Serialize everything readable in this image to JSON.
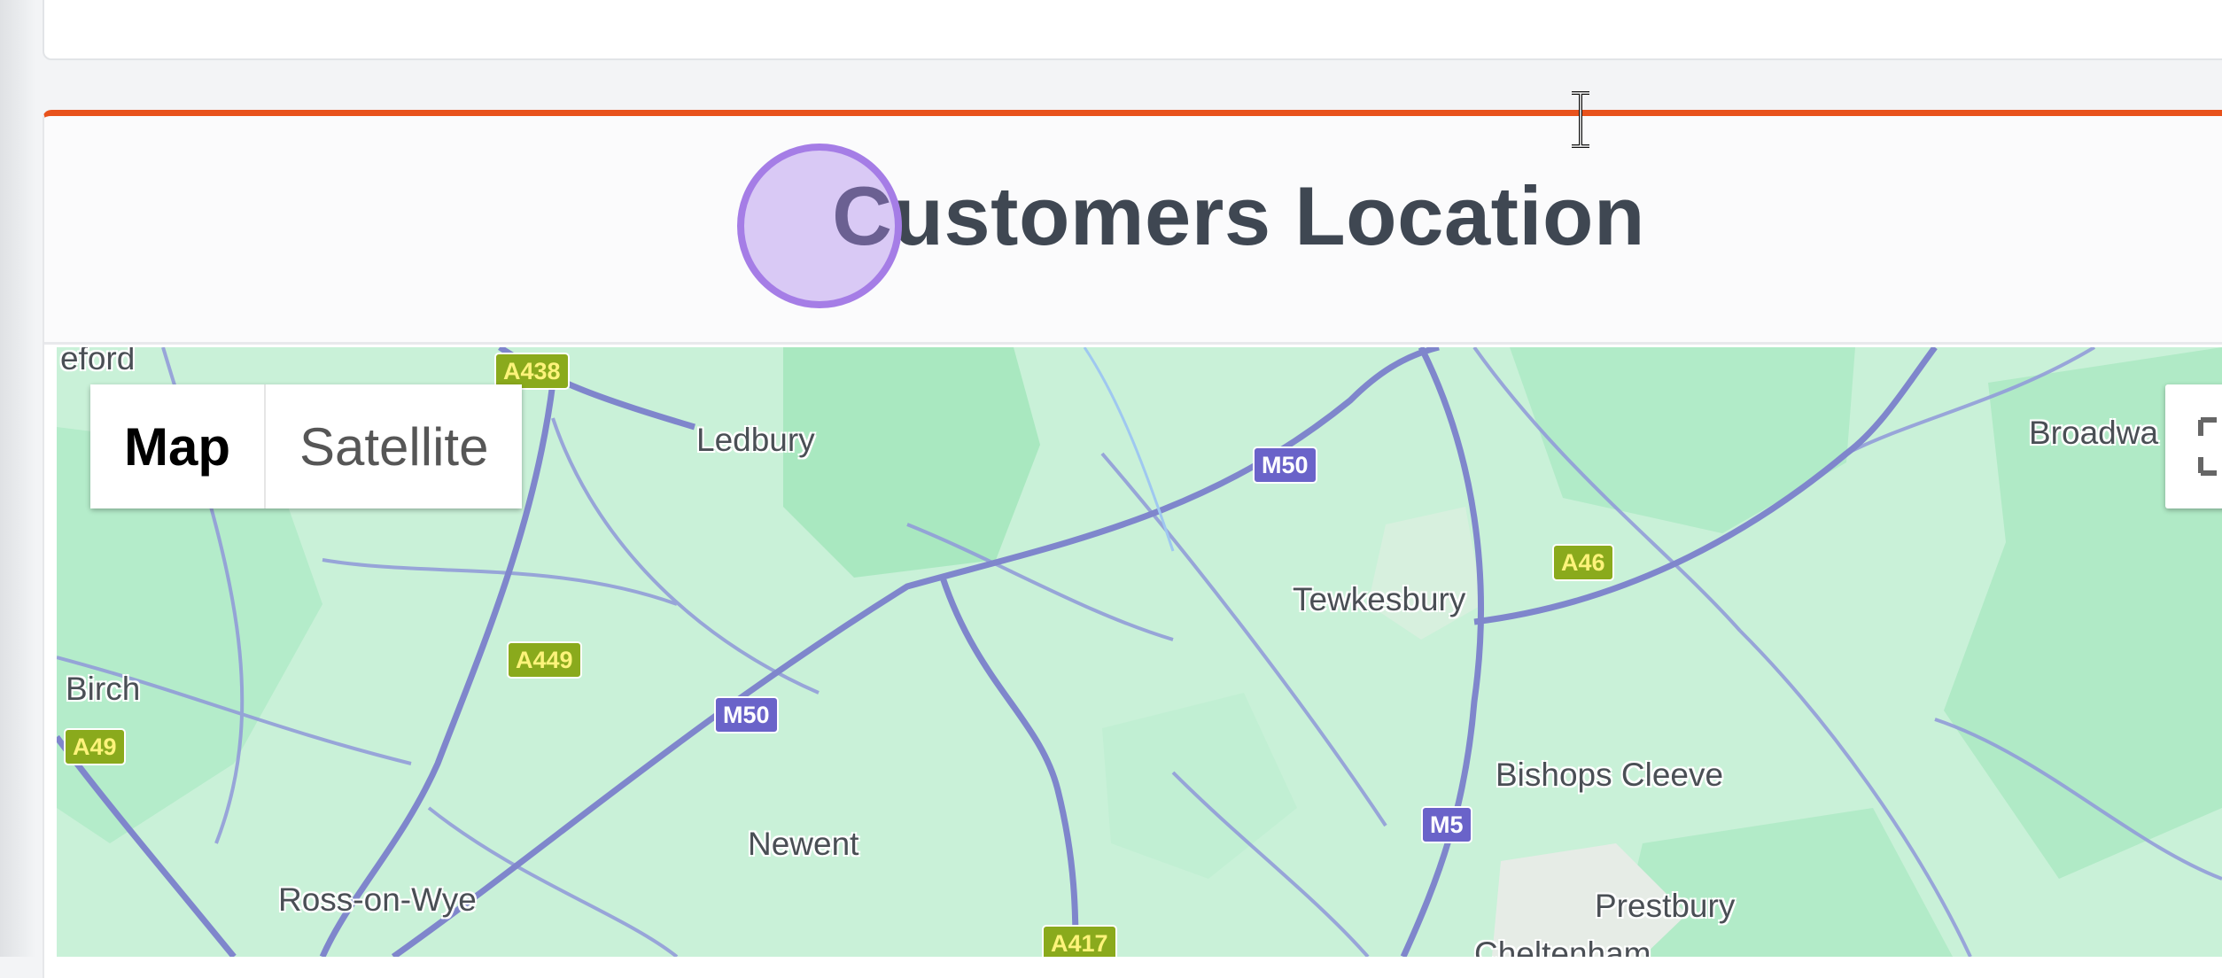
{
  "card": {
    "title": "Customers Location",
    "accent_color": "#e8521c"
  },
  "map": {
    "type_control": {
      "map_label": "Map",
      "satellite_label": "Satellite",
      "selected": "Map"
    },
    "fullscreen_icon": "fullscreen-icon",
    "places": [
      {
        "id": "hereford",
        "label": "eford"
      },
      {
        "id": "ledbury",
        "label": "Ledbury"
      },
      {
        "id": "tewkesbury",
        "label": "Tewkesbury"
      },
      {
        "id": "broadway",
        "label": "Broadwa"
      },
      {
        "id": "birch",
        "label": "Birch"
      },
      {
        "id": "newent",
        "label": "Newent"
      },
      {
        "id": "bishops-cleeve",
        "label": "Bishops Cleeve"
      },
      {
        "id": "ross-on-wye",
        "label": "Ross-on-Wye"
      },
      {
        "id": "prestbury",
        "label": "Prestbury"
      },
      {
        "id": "cheltenham",
        "label": "Cheltenham"
      }
    ],
    "roads": [
      {
        "id": "a438",
        "label": "A438"
      },
      {
        "id": "m50-north",
        "label": "M50"
      },
      {
        "id": "a46",
        "label": "A46"
      },
      {
        "id": "a449",
        "label": "A449"
      },
      {
        "id": "m50-south",
        "label": "M50"
      },
      {
        "id": "a49",
        "label": "A49"
      },
      {
        "id": "m5",
        "label": "M5"
      },
      {
        "id": "a417",
        "label": "A417"
      }
    ],
    "colors": {
      "land": "#c9f1d8",
      "forest": "#a8e6bf",
      "road": "#8891d6",
      "motorway_shield": "#6a63c9",
      "a_road_shield": "#8aaa1c"
    }
  }
}
